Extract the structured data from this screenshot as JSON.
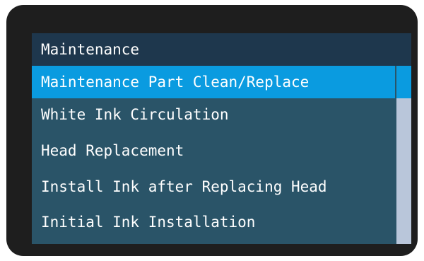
{
  "screen": {
    "title": "Maintenance",
    "menu": {
      "selected_index": 0,
      "items": [
        {
          "label": "Maintenance Part Clean/Replace"
        },
        {
          "label": "White Ink Circulation"
        },
        {
          "label": "Head Replacement"
        },
        {
          "label": "Install Ink after Replacing Head"
        },
        {
          "label": "Initial Ink Installation"
        }
      ]
    }
  },
  "colors": {
    "bezel": "#1e1e1e",
    "title_bar": "#1e374d",
    "list_background": "#2a5468",
    "selection": "#0a9be0",
    "scroll_track": "#b9c6da",
    "text": "#ffffff"
  }
}
